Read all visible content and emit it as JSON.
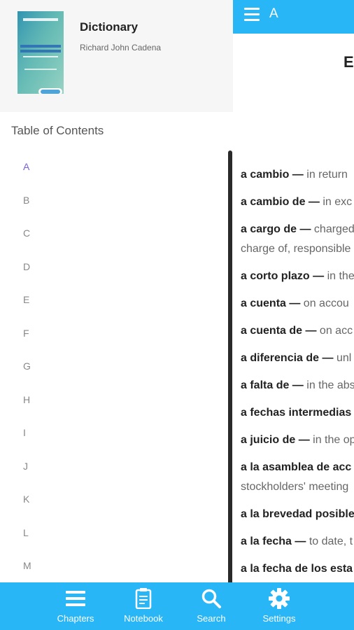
{
  "reader": {
    "header_title": "A",
    "heading": "E",
    "entries": [
      {
        "term": "a cambio —",
        "def": " in return"
      },
      {
        "term": "a cambio de —",
        "def": " in exc"
      },
      {
        "term": "a cargo de —",
        "def": " charged",
        "cont": "charge of, responsible"
      },
      {
        "term": "a corto plazo —",
        "def": " in the"
      },
      {
        "term": "a cuenta —",
        "def": " on accou"
      },
      {
        "term": "a cuenta de —",
        "def": " on acc"
      },
      {
        "term": "a diferencia de —",
        "def": " unl"
      },
      {
        "term": "a falta de —",
        "def": " in the abs"
      },
      {
        "term": "a fechas intermedias",
        "def": ""
      },
      {
        "term": "a juicio de —",
        "def": " in the op"
      },
      {
        "term": "a la asamblea de acc",
        "def": "",
        "cont": "stockholders' meeting"
      },
      {
        "term": "a la brevedad posible",
        "def": ""
      },
      {
        "term": "a la fecha —",
        "def": " to date, t"
      },
      {
        "term": "a la fecha de los esta",
        "def": ""
      }
    ]
  },
  "drawer": {
    "book_title": "Dictionary",
    "book_author": "Richard John Cadena",
    "toc_title": "Table of Contents",
    "toc_items": [
      "A",
      "B",
      "C",
      "D",
      "E",
      "F",
      "G",
      "H",
      "I",
      "J",
      "K",
      "L",
      "M"
    ],
    "active_item": "A"
  },
  "bottom_nav": [
    {
      "label": "Chapters",
      "icon": "list-icon"
    },
    {
      "label": "Notebook",
      "icon": "notebook-icon"
    },
    {
      "label": "Search",
      "icon": "search-icon"
    },
    {
      "label": "Settings",
      "icon": "gear-icon"
    }
  ],
  "colors": {
    "accent": "#29b6f6",
    "active_toc": "#7b61d9"
  }
}
